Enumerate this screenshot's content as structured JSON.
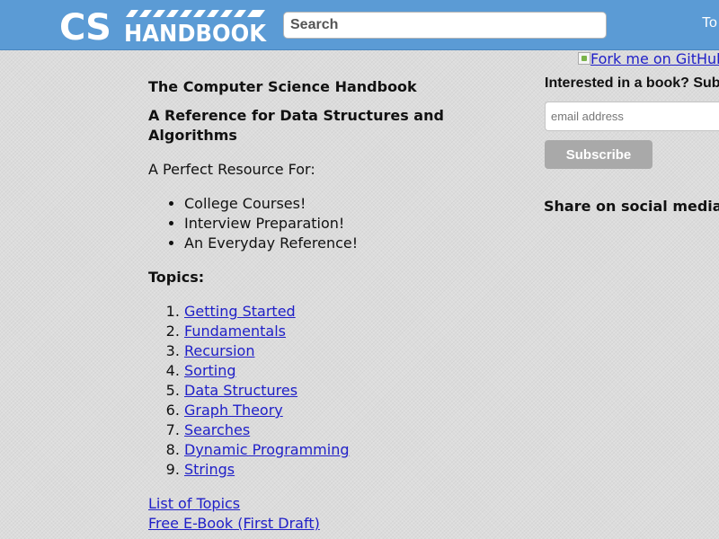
{
  "header": {
    "logo_text": "CS HANDBOOK",
    "logo_part1": "CS",
    "logo_part2": "HANDBOOK",
    "search_placeholder": "Search",
    "nav_link_partial": "To",
    "colors": {
      "bar": "#5b9bd5",
      "logo": "#ffffff"
    }
  },
  "main": {
    "title": "The Computer Science Handbook",
    "subtitle": "A Reference for Data Structures and Algorithms",
    "resource_intro": "A Perfect Resource For:",
    "audience": [
      "College Courses!",
      "Interview Preparation!",
      "An Everyday Reference!"
    ],
    "topics_heading": "Topics:",
    "topics": [
      "Getting Started",
      "Fundamentals",
      "Recursion",
      "Sorting",
      "Data Structures",
      "Graph Theory",
      "Searches",
      "Dynamic Programming",
      "Strings"
    ],
    "footer_links": {
      "list_of_topics": "List of Topics",
      "ebook": "Free E-Book (First Draft)"
    },
    "colors": {
      "link": "#2020c8"
    }
  },
  "sidebar": {
    "fork_banner_alt": "Fork me on GitHub",
    "newsletter_heading": "Interested in a book? Subscribe",
    "email_placeholder": "email address",
    "subscribe_label": "Subscribe",
    "share_heading": "Share on social media!",
    "colors": {
      "button": "#a9a9a9"
    }
  }
}
